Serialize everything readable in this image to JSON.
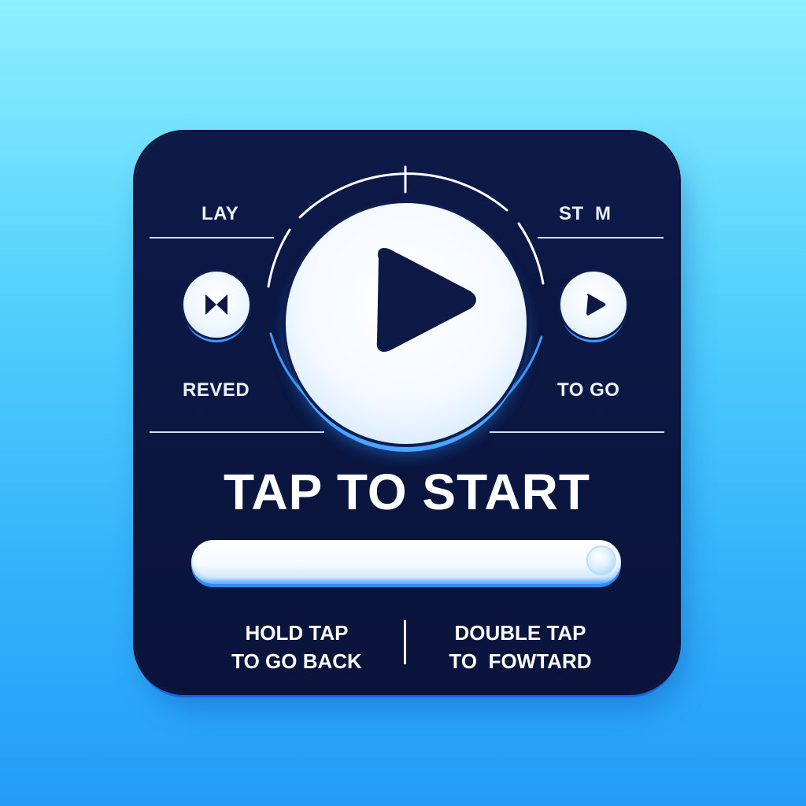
{
  "top_left_label": "LAY",
  "top_right_label": "ST  M",
  "left_control": {
    "label": "REVED",
    "icon": "rewind-icon"
  },
  "right_control": {
    "label": "TO GO",
    "icon": "play-icon"
  },
  "main_button": {
    "icon": "play-icon"
  },
  "headline": "TAP TO START",
  "progress": {
    "value": 1.0
  },
  "hints": {
    "left_line1": "HOLD TAP",
    "left_line2": "TO GO BACK",
    "right_line1": "DOUBLE TAP",
    "right_line2": "TO  FOWTARD"
  },
  "colors": {
    "card": "#0b1640",
    "accent": "#3f9bff",
    "text": "#ffffff"
  }
}
